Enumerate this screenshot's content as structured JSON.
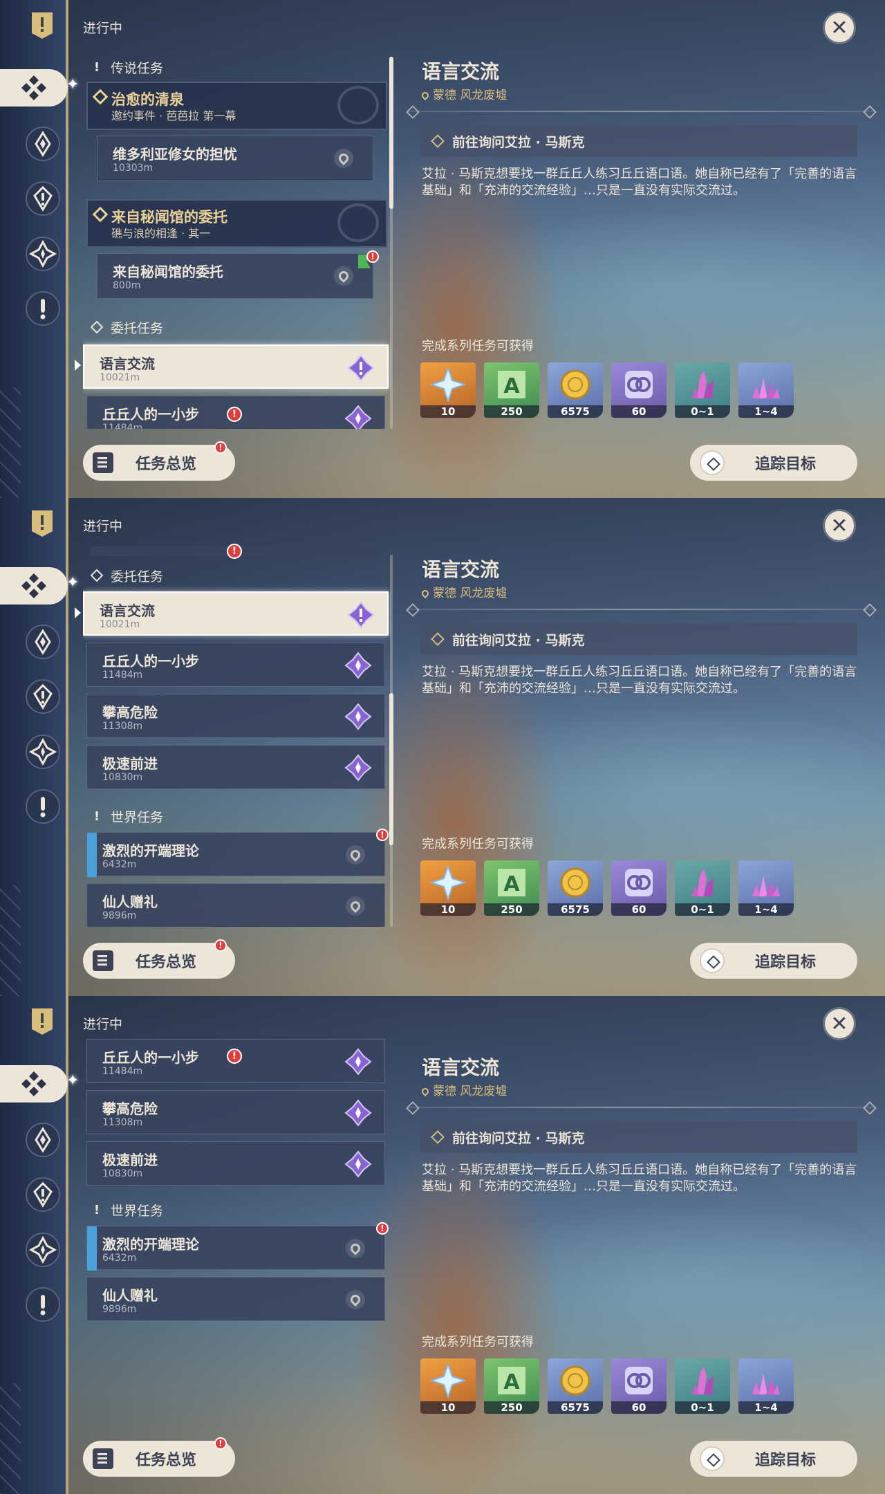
{
  "tab_label": "进行中",
  "categories": {
    "archon": "传说任务",
    "commission": "委托任务",
    "world": "世界任务"
  },
  "archon_quests": [
    {
      "title": "治愈的清泉",
      "subtitle": "邀约事件 · 芭芭拉 第一幕",
      "sub": {
        "title": "维多利亚修女的担忧",
        "distance": "10303m"
      }
    },
    {
      "title": "来自秘闻馆的委托",
      "subtitle": "礁与浪的相逢 · 其一",
      "sub": {
        "title": "来自秘闻馆的委托",
        "distance": "800m"
      }
    }
  ],
  "commission_quests": [
    {
      "title": "语言交流",
      "distance": "10021m"
    },
    {
      "title": "丘丘人的一小步",
      "distance": "11484m"
    },
    {
      "title": "攀高危险",
      "distance": "11308m"
    },
    {
      "title": "极速前进",
      "distance": "10830m"
    }
  ],
  "world_quests": [
    {
      "title": "激烈的开端理论",
      "distance": "6432m"
    },
    {
      "title": "仙人赠礼",
      "distance": "9896m"
    }
  ],
  "buttons": {
    "overview": "任务总览",
    "track": "追踪目标",
    "close": "✕"
  },
  "alert_mark": "!",
  "detail": {
    "title": "语言交流",
    "location": "蒙德 风龙废墟",
    "objective": "前往询问艾拉 · 马斯克",
    "description": "艾拉 · 马斯克想要找一群丘丘人练习丘丘语口语。她自称已经有了「完善的语言基础」和「充沛的交流经验」…只是一直没有实际交流过。",
    "rewards_label": "完成系列任务可获得",
    "rewards": [
      {
        "icon": "primogem-icon",
        "count": "10"
      },
      {
        "icon": "adventure-exp-icon",
        "count": "250"
      },
      {
        "icon": "mora-icon",
        "count": "6575"
      },
      {
        "icon": "friendship-exp-icon",
        "count": "60"
      },
      {
        "icon": "crystal-chunk-icon",
        "count": "0~1"
      },
      {
        "icon": "crystal-cluster-icon",
        "count": "1~4"
      }
    ]
  },
  "colors": {
    "sidebar": "#1e2a44",
    "card": "#38445e",
    "selected_card": "#ece5d8",
    "accent_gold": "#d9bd7c",
    "alert_red": "#e03d3d",
    "world_marker": "#4aa3d8",
    "commission_icon": "#8a63d2"
  }
}
